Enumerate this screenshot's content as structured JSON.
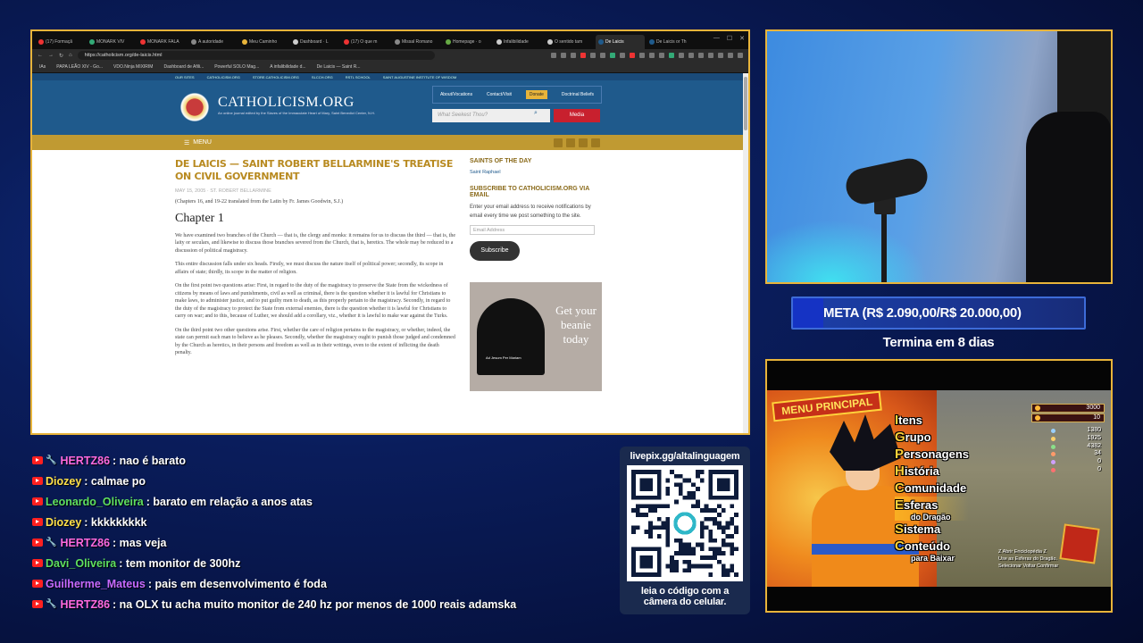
{
  "browser": {
    "tabs": [
      {
        "label": "(17) Formaçã",
        "color": "#e33"
      },
      {
        "label": "MONARK VIV",
        "color": "#3a7"
      },
      {
        "label": "MONARK FALA",
        "color": "#e33"
      },
      {
        "label": "A autoridade",
        "color": "#888"
      },
      {
        "label": "Meu Caminho",
        "color": "#e8b43a"
      },
      {
        "label": "Dashboard · L",
        "color": "#ccc"
      },
      {
        "label": "(17) O que m",
        "color": "#e33"
      },
      {
        "label": "Missal Romano",
        "color": "#888"
      },
      {
        "label": "Homepage · o",
        "color": "#6a4"
      },
      {
        "label": "Infalibilidade",
        "color": "#ccc"
      },
      {
        "label": "O sentido tam",
        "color": "#ccc"
      },
      {
        "label": "De Laicis",
        "color": "#1f5a8c"
      },
      {
        "label": "De Laicis or Th",
        "color": "#1f5a8c"
      }
    ],
    "url": "https://catholicism.org/de-laicis.html",
    "bookmarks": [
      "IAs",
      "PAPA LEÃO XIV - Go...",
      "VDO.Ninja MIXIRIM",
      "Dashboard de Afili...",
      "Powerful SOLO Mag...",
      "A infalibilidade d...",
      "De Laicis — Saint R..."
    ]
  },
  "site": {
    "top_links": [
      "OUR SITES",
      "CATHOLICISM.ORG",
      "STORE.CATHOLICISM.ORG",
      "SLCCH.ORG",
      "RSTL SCHOOL",
      "SAINT AUGUSTINE INSTITUTE OF WISDOM"
    ],
    "logo": "CATHOLICISM.ORG",
    "logo_sub": "An online journal edited by the Slaves of the Immaculate Heart of Mary, Saint Benedict Center, N.H.",
    "nav": {
      "about": "About/Vocations",
      "contact": "Contact/Visit",
      "donate": "Donate",
      "doctrinal": "Doctrinal Beliefs"
    },
    "search_placeholder": "What Seekest Thou?",
    "media": "Media",
    "menu": "MENU",
    "article": {
      "title": "De Laicis — Saint Robert Bellarmine's Treatise on Civil Government",
      "meta": "MAY 15, 2005   ·   ST. ROBERT BELLARMINE",
      "intro": "(Chapters 16, and 19-22 translated from the Latin by Fr. James Goodwin, S.J.)",
      "heading": "Chapter 1",
      "p1": "We have examined two branches of the Church — that is, the clergy and monks: it remains for us to discuss the third — that is, the laity or seculars, and likewise to discuss those branches severed from the Church, that is, heretics. The whole may be reduced to a discussion of political magistracy.",
      "p2": "This entire discussion falls under six heads. Firstly, we must discuss the nature itself of political power; secondly, its scope in affairs of state; thirdly, its scope in the matter of religion.",
      "p3": "On the first point two questions arise: First, in regard to the duty of the magistracy to preserve the State from the wickedness of citizens by means of laws and punishments, civil as well as criminal, there is the question whether it is lawful for Christians to make laws, to administer justice, and to put guilty men to death, as this properly pertain to the magistracy. Secondly, in regard to the duty of the magistracy to protect the State from external enemies, there is the question whether it is lawful for Christians to carry on war; and to this, because of Luther, we should add a corollary, viz., whether it is lawful to make war against the Turks.",
      "p4": "On the third point two other questions arise. First, whether the care of religion pertains to the magistracy, or whether, indeed, the state can permit each man to believe as he pleases. Secondly, whether the magistracy ought to punish those judged and condemned by the Church as heretics, in their persons and freedom as well as in their writings, even to the extent of inflicting the death penalty."
    },
    "sidebar": {
      "saints_heading": "SAINTS OF THE DAY",
      "saint": "Saint Raphael",
      "subscribe_heading": "SUBSCRIBE TO CATHOLICISM.ORG VIA EMAIL",
      "subscribe_text": "Enter your email address to receive notifications by email every time we post something to the site.",
      "email_placeholder": "Email Address",
      "subscribe_button": "Subscribe",
      "ad_text": "Get your beanie today",
      "beanie_label": "Ad Jesum Per Mariam"
    }
  },
  "meta": {
    "text": "META (R$ 2.090,00/R$ 20.000,00)",
    "progress_fraction": 0.1045,
    "ends": "Termina em 8 dias"
  },
  "game": {
    "menu_title": "MENU PRINCIPAL",
    "items": [
      {
        "first": "I",
        "rest": "tens",
        "sub": ""
      },
      {
        "first": "G",
        "rest": "rupo",
        "sub": ""
      },
      {
        "first": "P",
        "rest": "ersonagens",
        "sub": ""
      },
      {
        "first": "H",
        "rest": "istória",
        "sub": ""
      },
      {
        "first": "C",
        "rest": "omunidade",
        "sub": ""
      },
      {
        "first": "E",
        "rest": "sferas",
        "sub": "do Dragão"
      },
      {
        "first": "S",
        "rest": "istema",
        "sub": ""
      },
      {
        "first": "C",
        "rest": "onteúdo",
        "sub": "para Baixar"
      }
    ],
    "zeni": "3000",
    "points": "10",
    "stats": [
      {
        "value": "1380",
        "color": "#9ad0ff"
      },
      {
        "value": "1925",
        "color": "#ffd06a"
      },
      {
        "value": "4382",
        "color": "#8ae08a"
      },
      {
        "value": "34",
        "color": "#ff9a6a"
      },
      {
        "value": "0",
        "color": "#d0a0ff"
      },
      {
        "value": "0",
        "color": "#ff7070"
      }
    ],
    "help_1": "Z  Abrir Enciclopédia Z",
    "help_2": "Use as Esferas do Dragão.",
    "help_3": "Selecionar   Voltar   Confirmar"
  },
  "chat": [
    {
      "user": "HERTZ86",
      "message": ": nao é barato",
      "color": "#ff6adf",
      "mod": true
    },
    {
      "user": "Diozey",
      "message": ": calmae po",
      "color": "#ffe04a",
      "mod": false
    },
    {
      "user": "Leonardo_Oliveira",
      "message": ": barato em relação a anos atas",
      "color": "#5fe05f",
      "mod": false
    },
    {
      "user": "Diozey",
      "message": ": kkkkkkkkk",
      "color": "#ffe04a",
      "mod": false
    },
    {
      "user": "HERTZ86",
      "message": ": mas veja",
      "color": "#ff6adf",
      "mod": true
    },
    {
      "user": "Davi_Oliveira",
      "message": ": tem monitor de 300hz",
      "color": "#5fe05f",
      "mod": false
    },
    {
      "user": "Guilherme_Mateus",
      "message": ": pais em desenvolvimento é foda",
      "color": "#c86aff",
      "mod": false
    },
    {
      "user": "HERTZ86",
      "message": ": na OLX tu acha muito monitor de 240 hz por menos de 1000 reais adamska",
      "color": "#ff6adf",
      "mod": true
    }
  ],
  "qr": {
    "url": "livepix.gg/altalinguagem",
    "caption_1": "leia o código com a",
    "caption_2": "câmera do celular."
  }
}
